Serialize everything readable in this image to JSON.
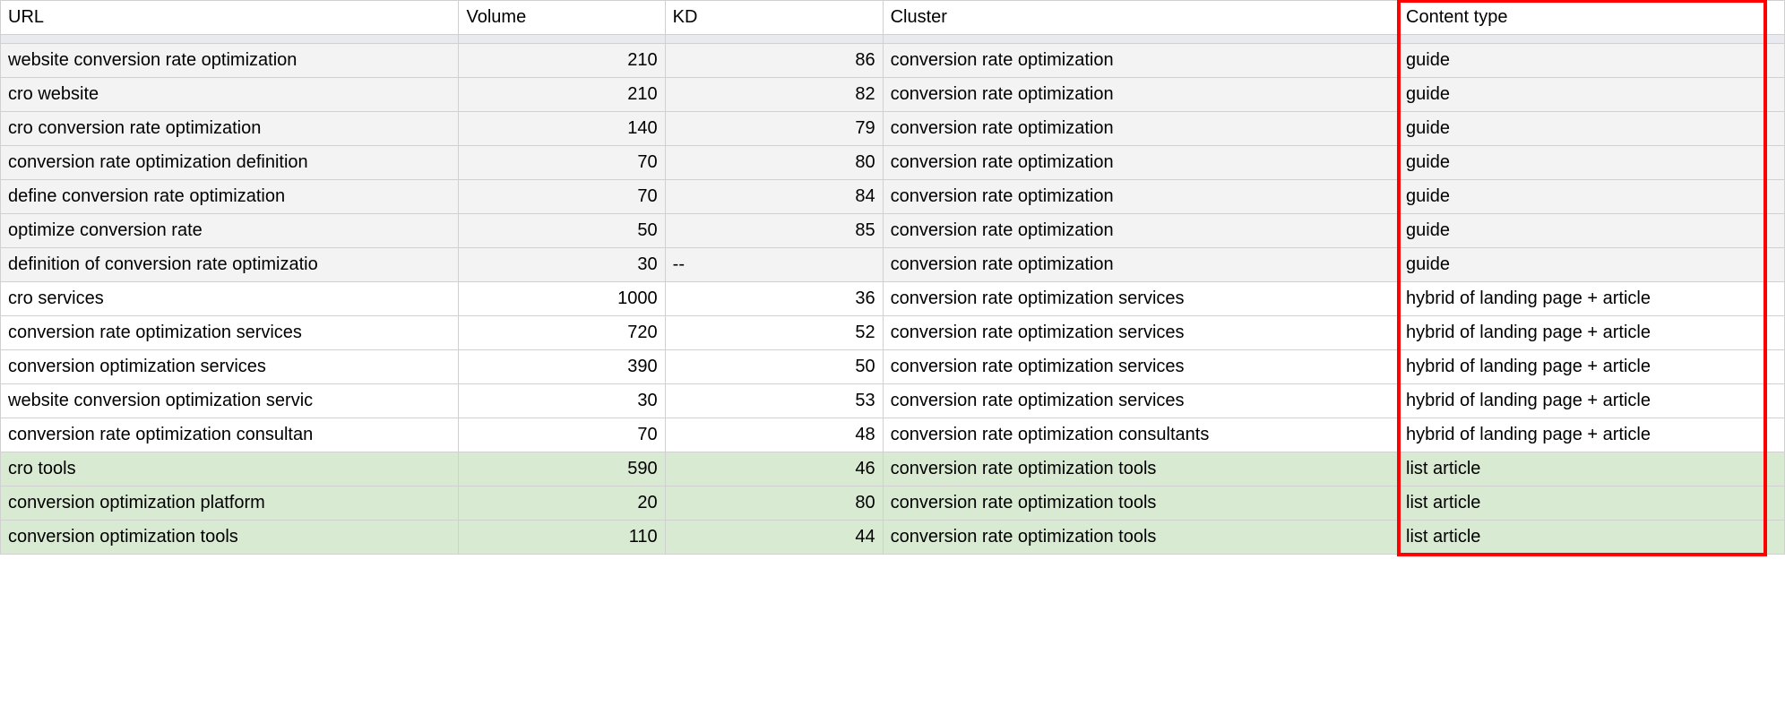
{
  "columns": {
    "url": "URL",
    "volume": "Volume",
    "kd": "KD",
    "cluster": "Cluster",
    "content_type": "Content type"
  },
  "rows": [
    {
      "url": "website conversion rate optimization",
      "volume": "210",
      "kd": "86",
      "cluster": "conversion rate optimization",
      "content_type": "guide",
      "shade": "gray"
    },
    {
      "url": "cro website",
      "volume": "210",
      "kd": "82",
      "cluster": "conversion rate optimization",
      "content_type": "guide",
      "shade": "gray"
    },
    {
      "url": "cro conversion rate optimization",
      "volume": "140",
      "kd": "79",
      "cluster": "conversion rate optimization",
      "content_type": "guide",
      "shade": "gray"
    },
    {
      "url": "conversion rate optimization definition",
      "volume": "70",
      "kd": "80",
      "cluster": "conversion rate optimization",
      "content_type": "guide",
      "shade": "gray"
    },
    {
      "url": "define conversion rate optimization",
      "volume": "70",
      "kd": "84",
      "cluster": "conversion rate optimization",
      "content_type": "guide",
      "shade": "gray"
    },
    {
      "url": "optimize conversion rate",
      "volume": "50",
      "kd": "85",
      "cluster": "conversion rate optimization",
      "content_type": "guide",
      "shade": "gray"
    },
    {
      "url": "definition of conversion rate optimizatio",
      "volume": "30",
      "kd": "--",
      "kd_align": "left",
      "cluster": "conversion rate optimization",
      "content_type": "guide",
      "shade": "gray"
    },
    {
      "url": "cro services",
      "volume": "1000",
      "kd": "36",
      "cluster": "conversion rate optimization services",
      "content_type": "hybrid of landing page + article",
      "shade": "white"
    },
    {
      "url": "conversion rate optimization services",
      "volume": "720",
      "kd": "52",
      "cluster": "conversion rate optimization services",
      "content_type": "hybrid of landing page + article",
      "shade": "white"
    },
    {
      "url": "conversion optimization services",
      "volume": "390",
      "kd": "50",
      "cluster": "conversion rate optimization services",
      "content_type": "hybrid of landing page + article",
      "shade": "white"
    },
    {
      "url": "website conversion optimization servic",
      "volume": "30",
      "kd": "53",
      "cluster": "conversion rate optimization services",
      "content_type": "hybrid of landing page + article",
      "shade": "white"
    },
    {
      "url": "conversion rate optimization consultan",
      "volume": "70",
      "kd": "48",
      "cluster": "conversion rate optimization consultants",
      "content_type": "hybrid of landing page + article",
      "shade": "white"
    },
    {
      "url": "cro tools",
      "volume": "590",
      "kd": "46",
      "cluster": "conversion rate optimization tools",
      "content_type": "list article",
      "shade": "green"
    },
    {
      "url": "conversion optimization platform",
      "volume": "20",
      "kd": "80",
      "cluster": "conversion rate optimization tools",
      "content_type": "list article",
      "shade": "green"
    },
    {
      "url": "conversion optimization tools",
      "volume": "110",
      "kd": "44",
      "cluster": "conversion rate optimization tools",
      "content_type": "list article",
      "shade": "green"
    }
  ],
  "highlight": {
    "column": "content_type"
  }
}
